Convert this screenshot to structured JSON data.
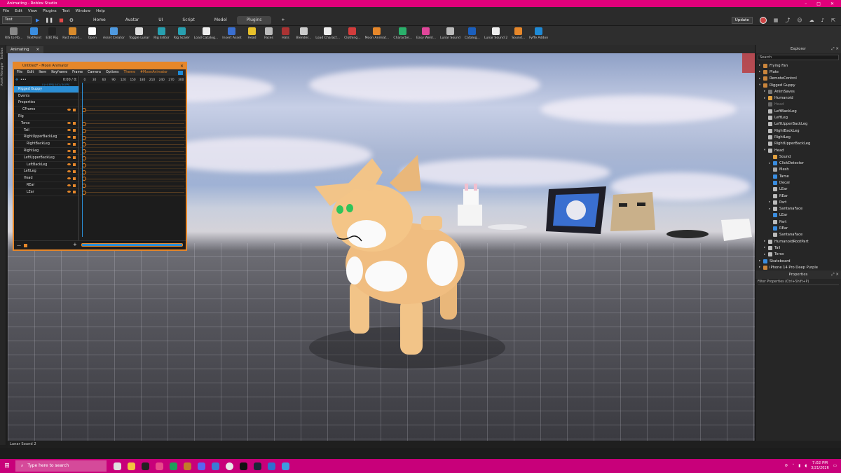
{
  "window": {
    "title": "Animating - Roblox Studio"
  },
  "menu": [
    "File",
    "Edit",
    "View",
    "Plugins",
    "Test",
    "Window",
    "Help"
  ],
  "tabrow": {
    "test_select": "Test",
    "tabs": [
      "Home",
      "Avatar",
      "UI",
      "Script",
      "Model",
      "Plugins",
      "+"
    ],
    "update_label": "Update"
  },
  "toolbar": [
    {
      "label": "RIS to Rb...",
      "color": "#888888"
    },
    {
      "label": "TextPoint",
      "color": "#3a8de0"
    },
    {
      "label": "Edit Rig",
      "color": "#222222"
    },
    {
      "label": "Fast Asset...",
      "color": "#d98b2c"
    },
    {
      "label": "Open",
      "color": "#ffffff"
    },
    {
      "label": "Asset Creator",
      "color": "#4f9ae0"
    },
    {
      "label": "Toggle Lunar",
      "color": "#dddddd"
    },
    {
      "label": "Rig Editor",
      "color": "#28a0b0"
    },
    {
      "label": "Rig Scaler",
      "color": "#28a0b0"
    },
    {
      "label": "Load Catalog...",
      "color": "#eeeeee"
    },
    {
      "label": "Insert Asset",
      "color": "#3a6fd0"
    },
    {
      "label": "Head",
      "color": "#e8c12b"
    },
    {
      "label": "Faces",
      "color": "#bbbbbb"
    },
    {
      "label": "Hats",
      "color": "#a33"
    },
    {
      "label": "Blender...",
      "color": "#cccccc"
    },
    {
      "label": "Load Charact...",
      "color": "#eeeeee"
    },
    {
      "label": "Clothing...",
      "color": "#d23c3c"
    },
    {
      "label": "Moon Animat...",
      "color": "#e6872a"
    },
    {
      "label": "Character...",
      "color": "#2ab06b"
    },
    {
      "label": "Easy Weld...",
      "color": "#e0469a"
    },
    {
      "label": "Lunar Sound",
      "color": "#bbbbbb"
    },
    {
      "label": "Catalog...",
      "color": "#1b5fbd"
    },
    {
      "label": "Lunar Sound 2",
      "color": "#eeeeee"
    },
    {
      "label": "Sound...",
      "color": "#e6872a"
    },
    {
      "label": "Fyffe Addon",
      "color": "#1e8ad6"
    }
  ],
  "side_strip": [
    "Toolbox",
    "Asset Manager"
  ],
  "doc_tab": {
    "label": "Animating",
    "close": "×"
  },
  "moon": {
    "title": "Untitled* - Moon Animator",
    "menu": [
      "File",
      "Edit",
      "Item",
      "Keyframe",
      "Frame",
      "Camera",
      "Options",
      "Theme",
      "#MoonAnimator"
    ],
    "time_display": "0:00 / 0:",
    "time_sub": "0 (+0 FPS) 0:01 / 30 FPS",
    "ruler": [
      "0",
      "30",
      "60",
      "90",
      "120",
      "150",
      "180",
      "210",
      "240",
      "270",
      "300"
    ],
    "rows": [
      {
        "name": "Rigged Guppy",
        "indent": 6,
        "selected": true,
        "keyframe": false
      },
      {
        "name": "Events",
        "indent": 6,
        "selected": false,
        "keyframe": false
      },
      {
        "name": "Properties",
        "indent": 6,
        "selected": false,
        "keyframe": false
      },
      {
        "name": "CFrame",
        "indent": 12,
        "selected": false,
        "keyframe": true
      },
      {
        "name": "Rig",
        "indent": 6,
        "selected": false,
        "keyframe": false
      },
      {
        "name": "Torso",
        "indent": 10,
        "selected": false,
        "keyframe": true
      },
      {
        "name": "Tail",
        "indent": 14,
        "selected": false,
        "keyframe": true
      },
      {
        "name": "RightUpperBackLeg",
        "indent": 14,
        "selected": false,
        "keyframe": true
      },
      {
        "name": "RightBackLeg",
        "indent": 18,
        "selected": false,
        "keyframe": true
      },
      {
        "name": "RightLeg",
        "indent": 14,
        "selected": false,
        "keyframe": true
      },
      {
        "name": "LeftUpperBackLeg",
        "indent": 14,
        "selected": false,
        "keyframe": true
      },
      {
        "name": "LeftBackLeg",
        "indent": 18,
        "selected": false,
        "keyframe": true
      },
      {
        "name": "LeftLeg",
        "indent": 14,
        "selected": false,
        "keyframe": true
      },
      {
        "name": "Head",
        "indent": 14,
        "selected": false,
        "keyframe": true
      },
      {
        "name": "REar",
        "indent": 18,
        "selected": false,
        "keyframe": true
      },
      {
        "name": "LEar",
        "indent": 18,
        "selected": false,
        "keyframe": true
      }
    ]
  },
  "explorer": {
    "title": "Explorer",
    "search_placeholder": "Search",
    "items": [
      {
        "name": "Flying Fan",
        "depth": 1,
        "arrow": "▸",
        "color": "#c9853c",
        "dim": false
      },
      {
        "name": "Plate",
        "depth": 1,
        "arrow": "▸",
        "color": "#c9853c",
        "dim": false
      },
      {
        "name": "RemoteControl",
        "depth": 1,
        "arrow": "▸",
        "color": "#c9853c",
        "dim": false
      },
      {
        "name": "Rigged Guppy",
        "depth": 1,
        "arrow": "▾",
        "color": "#c9853c",
        "dim": false
      },
      {
        "name": "AnimSaves",
        "depth": 2,
        "arrow": "▸",
        "color": "#777777",
        "dim": false
      },
      {
        "name": "Humanoid",
        "depth": 2,
        "arrow": "▸",
        "color": "#e0a040",
        "dim": false
      },
      {
        "name": "Head",
        "depth": 2,
        "arrow": "",
        "color": "#666666",
        "dim": true
      },
      {
        "name": "LeftBackLeg",
        "depth": 2,
        "arrow": "",
        "color": "#bbbbbb",
        "dim": false
      },
      {
        "name": "LeftLeg",
        "depth": 2,
        "arrow": "",
        "color": "#bbbbbb",
        "dim": false
      },
      {
        "name": "LeftUpperBackLeg",
        "depth": 2,
        "arrow": "",
        "color": "#bbbbbb",
        "dim": false
      },
      {
        "name": "RightBackLeg",
        "depth": 2,
        "arrow": "",
        "color": "#bbbbbb",
        "dim": false
      },
      {
        "name": "RightLeg",
        "depth": 2,
        "arrow": "",
        "color": "#bbbbbb",
        "dim": false
      },
      {
        "name": "RightUpperBackLeg",
        "depth": 2,
        "arrow": "",
        "color": "#bbbbbb",
        "dim": false
      },
      {
        "name": "Head",
        "depth": 2,
        "arrow": "▾",
        "color": "#bbbbbb",
        "dim": false
      },
      {
        "name": "Sound",
        "depth": 3,
        "arrow": "",
        "color": "#e0a040",
        "dim": false
      },
      {
        "name": "ClickDetector",
        "depth": 3,
        "arrow": "▸",
        "color": "#3a8de0",
        "dim": false
      },
      {
        "name": "Mesh",
        "depth": 3,
        "arrow": "",
        "color": "#aaaaaa",
        "dim": false
      },
      {
        "name": "Tame",
        "depth": 3,
        "arrow": "",
        "color": "#3a8de0",
        "dim": false
      },
      {
        "name": "Decal",
        "depth": 3,
        "arrow": "",
        "color": "#3a8de0",
        "dim": false
      },
      {
        "name": "LEar",
        "depth": 3,
        "arrow": "",
        "color": "#bbbbbb",
        "dim": false
      },
      {
        "name": "REar",
        "depth": 3,
        "arrow": "",
        "color": "#bbbbbb",
        "dim": false
      },
      {
        "name": "Part",
        "depth": 3,
        "arrow": "▸",
        "color": "#bbbbbb",
        "dim": false
      },
      {
        "name": "SantanaFace",
        "depth": 3,
        "arrow": "▸",
        "color": "#bbbbbb",
        "dim": false
      },
      {
        "name": "LEar",
        "depth": 3,
        "arrow": "",
        "color": "#3a8de0",
        "dim": false
      },
      {
        "name": "Part",
        "depth": 3,
        "arrow": "",
        "color": "#bbbbbb",
        "dim": false
      },
      {
        "name": "REar",
        "depth": 3,
        "arrow": "",
        "color": "#3a8de0",
        "dim": false
      },
      {
        "name": "SantanaFace",
        "depth": 3,
        "arrow": "",
        "color": "#bbbbbb",
        "dim": false
      },
      {
        "name": "HumanoidRootPart",
        "depth": 2,
        "arrow": "▸",
        "color": "#bbbbbb",
        "dim": false
      },
      {
        "name": "Tail",
        "depth": 2,
        "arrow": "▸",
        "color": "#bbbbbb",
        "dim": false
      },
      {
        "name": "Torso",
        "depth": 2,
        "arrow": "▸",
        "color": "#bbbbbb",
        "dim": false
      },
      {
        "name": "Skateboard",
        "depth": 1,
        "arrow": "▸",
        "color": "#3a8de0",
        "dim": false
      },
      {
        "name": "iPhone 14 Pro Deep Purple",
        "depth": 1,
        "arrow": "▸",
        "color": "#c9853c",
        "dim": false
      }
    ]
  },
  "properties": {
    "title": "Properties",
    "filter_placeholder": "Filter Properties (Ctrl+Shift+P)"
  },
  "status_bar": "Lunar Sound 2",
  "taskbar": {
    "search_placeholder": "Type here to search",
    "time": "7:02 PM",
    "date": "3/21/2026"
  }
}
